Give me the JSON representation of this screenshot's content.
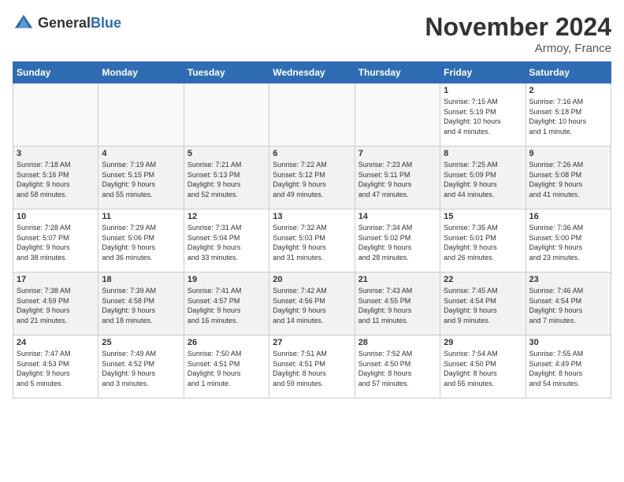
{
  "logo": {
    "general": "General",
    "blue": "Blue"
  },
  "header": {
    "month": "November 2024",
    "location": "Armoy, France"
  },
  "days_of_week": [
    "Sunday",
    "Monday",
    "Tuesday",
    "Wednesday",
    "Thursday",
    "Friday",
    "Saturday"
  ],
  "weeks": [
    [
      {
        "day": "",
        "info": ""
      },
      {
        "day": "",
        "info": ""
      },
      {
        "day": "",
        "info": ""
      },
      {
        "day": "",
        "info": ""
      },
      {
        "day": "",
        "info": ""
      },
      {
        "day": "1",
        "info": "Sunrise: 7:15 AM\nSunset: 5:19 PM\nDaylight: 10 hours\nand 4 minutes."
      },
      {
        "day": "2",
        "info": "Sunrise: 7:16 AM\nSunset: 5:18 PM\nDaylight: 10 hours\nand 1 minute."
      }
    ],
    [
      {
        "day": "3",
        "info": "Sunrise: 7:18 AM\nSunset: 5:16 PM\nDaylight: 9 hours\nand 58 minutes."
      },
      {
        "day": "4",
        "info": "Sunrise: 7:19 AM\nSunset: 5:15 PM\nDaylight: 9 hours\nand 55 minutes."
      },
      {
        "day": "5",
        "info": "Sunrise: 7:21 AM\nSunset: 5:13 PM\nDaylight: 9 hours\nand 52 minutes."
      },
      {
        "day": "6",
        "info": "Sunrise: 7:22 AM\nSunset: 5:12 PM\nDaylight: 9 hours\nand 49 minutes."
      },
      {
        "day": "7",
        "info": "Sunrise: 7:23 AM\nSunset: 5:11 PM\nDaylight: 9 hours\nand 47 minutes."
      },
      {
        "day": "8",
        "info": "Sunrise: 7:25 AM\nSunset: 5:09 PM\nDaylight: 9 hours\nand 44 minutes."
      },
      {
        "day": "9",
        "info": "Sunrise: 7:26 AM\nSunset: 5:08 PM\nDaylight: 9 hours\nand 41 minutes."
      }
    ],
    [
      {
        "day": "10",
        "info": "Sunrise: 7:28 AM\nSunset: 5:07 PM\nDaylight: 9 hours\nand 38 minutes."
      },
      {
        "day": "11",
        "info": "Sunrise: 7:29 AM\nSunset: 5:06 PM\nDaylight: 9 hours\nand 36 minutes."
      },
      {
        "day": "12",
        "info": "Sunrise: 7:31 AM\nSunset: 5:04 PM\nDaylight: 9 hours\nand 33 minutes."
      },
      {
        "day": "13",
        "info": "Sunrise: 7:32 AM\nSunset: 5:03 PM\nDaylight: 9 hours\nand 31 minutes."
      },
      {
        "day": "14",
        "info": "Sunrise: 7:34 AM\nSunset: 5:02 PM\nDaylight: 9 hours\nand 28 minutes."
      },
      {
        "day": "15",
        "info": "Sunrise: 7:35 AM\nSunset: 5:01 PM\nDaylight: 9 hours\nand 26 minutes."
      },
      {
        "day": "16",
        "info": "Sunrise: 7:36 AM\nSunset: 5:00 PM\nDaylight: 9 hours\nand 23 minutes."
      }
    ],
    [
      {
        "day": "17",
        "info": "Sunrise: 7:38 AM\nSunset: 4:59 PM\nDaylight: 9 hours\nand 21 minutes."
      },
      {
        "day": "18",
        "info": "Sunrise: 7:39 AM\nSunset: 4:58 PM\nDaylight: 9 hours\nand 18 minutes."
      },
      {
        "day": "19",
        "info": "Sunrise: 7:41 AM\nSunset: 4:57 PM\nDaylight: 9 hours\nand 16 minutes."
      },
      {
        "day": "20",
        "info": "Sunrise: 7:42 AM\nSunset: 4:56 PM\nDaylight: 9 hours\nand 14 minutes."
      },
      {
        "day": "21",
        "info": "Sunrise: 7:43 AM\nSunset: 4:55 PM\nDaylight: 9 hours\nand 11 minutes."
      },
      {
        "day": "22",
        "info": "Sunrise: 7:45 AM\nSunset: 4:54 PM\nDaylight: 9 hours\nand 9 minutes."
      },
      {
        "day": "23",
        "info": "Sunrise: 7:46 AM\nSunset: 4:54 PM\nDaylight: 9 hours\nand 7 minutes."
      }
    ],
    [
      {
        "day": "24",
        "info": "Sunrise: 7:47 AM\nSunset: 4:53 PM\nDaylight: 9 hours\nand 5 minutes."
      },
      {
        "day": "25",
        "info": "Sunrise: 7:49 AM\nSunset: 4:52 PM\nDaylight: 9 hours\nand 3 minutes."
      },
      {
        "day": "26",
        "info": "Sunrise: 7:50 AM\nSunset: 4:51 PM\nDaylight: 9 hours\nand 1 minute."
      },
      {
        "day": "27",
        "info": "Sunrise: 7:51 AM\nSunset: 4:51 PM\nDaylight: 8 hours\nand 59 minutes."
      },
      {
        "day": "28",
        "info": "Sunrise: 7:52 AM\nSunset: 4:50 PM\nDaylight: 8 hours\nand 57 minutes."
      },
      {
        "day": "29",
        "info": "Sunrise: 7:54 AM\nSunset: 4:50 PM\nDaylight: 8 hours\nand 55 minutes."
      },
      {
        "day": "30",
        "info": "Sunrise: 7:55 AM\nSunset: 4:49 PM\nDaylight: 8 hours\nand 54 minutes."
      }
    ]
  ]
}
